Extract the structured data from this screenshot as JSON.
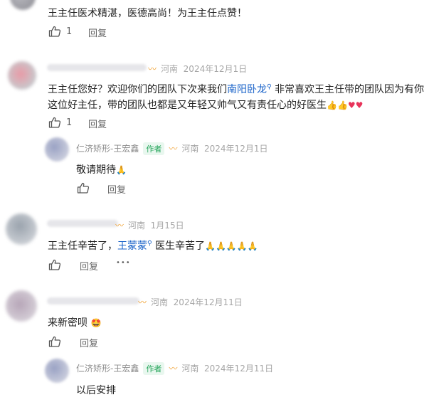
{
  "comments": [
    {
      "text": "王主任医术精湛，医德高尚！为王主任点赞！",
      "likes": "1",
      "reply_label": "回复"
    },
    {
      "location": "河南",
      "date": "2024年12月1日",
      "text_line1_a": "王主任您好？欢迎你们的团队下次来我们",
      "text_line1_link": "南阳卧龙",
      "text_line1_b": "非常喜欢王主任带的团队因为有你",
      "text_line2": "这位好主任，带的团队也都是又年轻又帅气又有责任心的好医生",
      "likes": "1",
      "reply_label": "回复",
      "reply": {
        "author": "仁济矫形-王宏鑫",
        "badge": "作者",
        "location": "河南",
        "date": "2024年12月1日",
        "text": "敬请期待",
        "reply_label": "回复"
      }
    },
    {
      "location": "河南",
      "date": "1月15日",
      "text_a": "王主任辛苦了，",
      "text_link": "王蒙蒙",
      "text_b": "医生辛苦了",
      "reply_label": "回复",
      "more": "•••"
    },
    {
      "location": "河南",
      "date": "2024年12月11日",
      "text": "来新密呗",
      "reply_label": "回复",
      "reply": {
        "author": "仁济矫形-王宏鑫",
        "badge": "作者",
        "location": "河南",
        "date": "2024年12月11日",
        "text": "以后安排"
      }
    }
  ],
  "colors": {
    "link": "#1a63c9",
    "author_badge": "#25a55a",
    "meta": "#a6a6a6"
  },
  "icons": {
    "like": "thumbs-up-icon",
    "search": "search-icon",
    "author_mark": "wechat-channels-icon"
  }
}
